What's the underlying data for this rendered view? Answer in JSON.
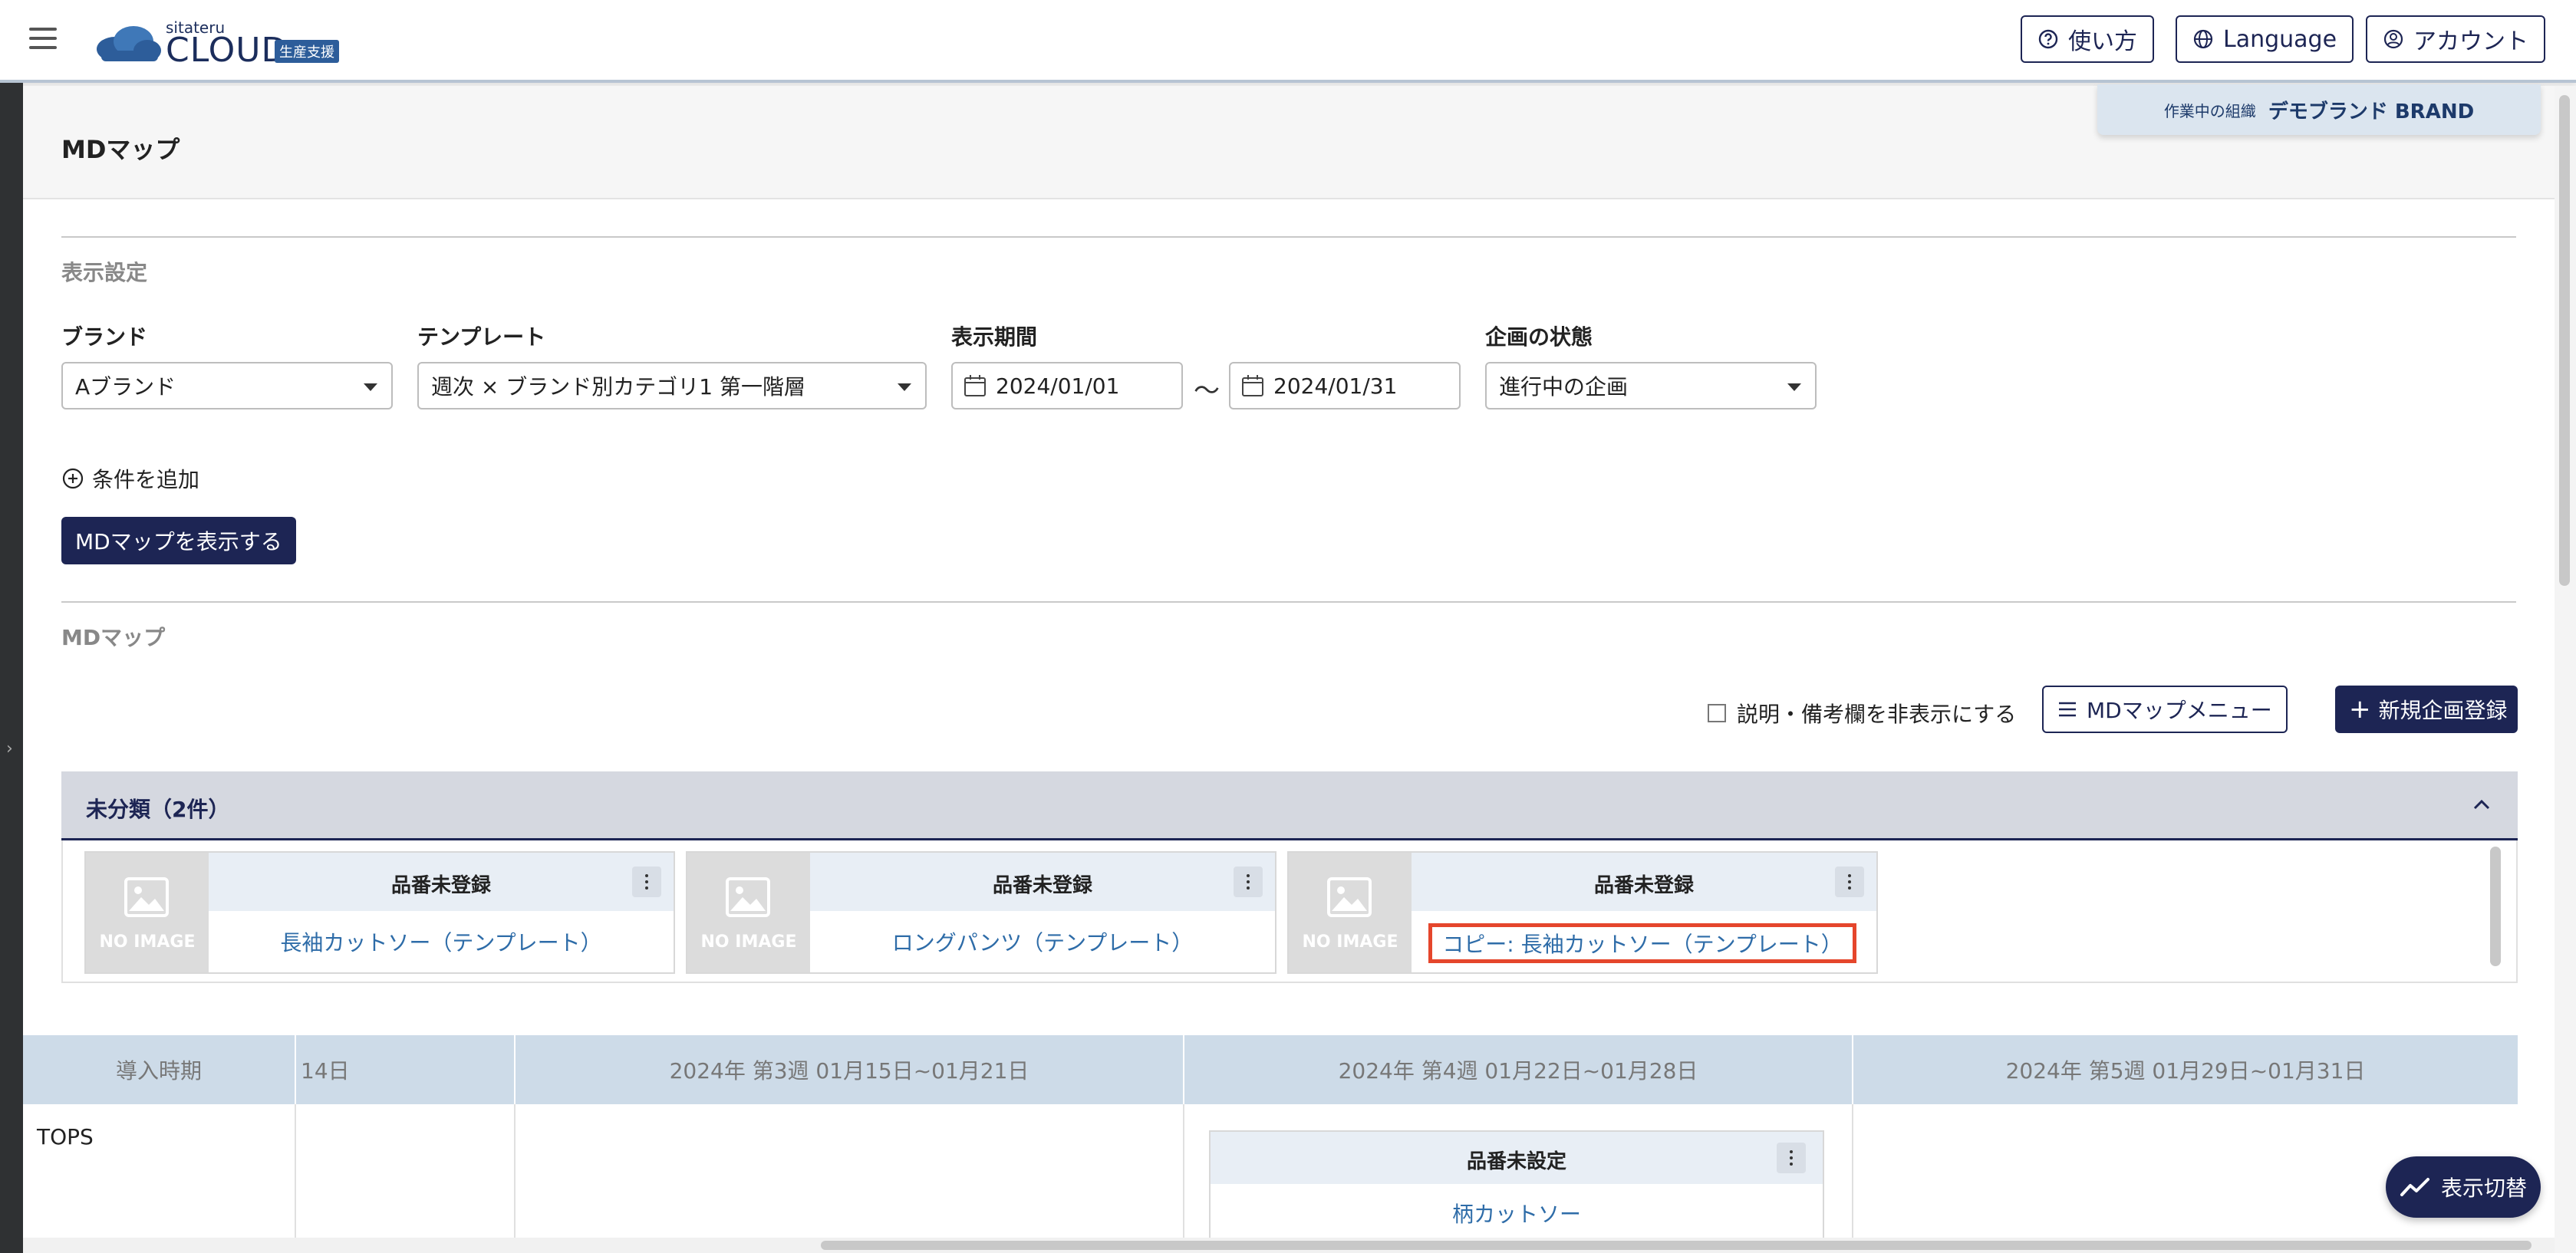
{
  "header": {
    "logo_small": "sitateru",
    "logo_main": "CLOUD",
    "logo_badge": "生産支援",
    "help_label": "使い方",
    "language_label": "Language",
    "account_label": "アカウント"
  },
  "org": {
    "label": "作業中の組織",
    "value": "デモブランド BRAND"
  },
  "page": {
    "title": "MDマップ"
  },
  "settings": {
    "section_title": "表示設定",
    "brand_label": "ブランド",
    "brand_value": "Aブランド",
    "template_label": "テンプレート",
    "template_value": "週次 × ブランド別カテゴリ1 第一階層",
    "period_label": "表示期間",
    "period_start": "2024/01/01",
    "period_tilde": "〜",
    "period_end": "2024/01/31",
    "status_label": "企画の状態",
    "status_value": "進行中の企画",
    "add_condition": "条件を追加",
    "show_button": "MDマップを表示する"
  },
  "mdmap": {
    "section_title": "MDマップ",
    "hide_notes_label": "説明・備考欄を非表示にする",
    "menu_button": "MDマップメニュー",
    "new_button": "新規企画登録"
  },
  "uncategorized": {
    "title": "未分類（2件）",
    "cards": [
      {
        "code": "品番未登録",
        "name": "長袖カットソー（テンプレート）",
        "noimage": "NO IMAGE"
      },
      {
        "code": "品番未登録",
        "name": "ロングパンツ（テンプレート）",
        "noimage": "NO IMAGE"
      },
      {
        "code": "品番未登録",
        "name": "コピー: 長袖カットソー（テンプレート）",
        "noimage": "NO IMAGE"
      }
    ]
  },
  "timeline": {
    "columns": [
      "導入時期",
      "14日",
      "2024年 第3週 01月15日~01月21日",
      "2024年 第4週 01月22日~01月28日",
      "2024年 第5週 01月29日~01月31日"
    ],
    "rows": [
      {
        "label": "TOPS",
        "card": {
          "code": "品番未設定",
          "name": "柄カットソー"
        }
      }
    ]
  },
  "fab": {
    "label": "表示切替"
  },
  "colors": {
    "primary": "#1d2554",
    "link": "#2e6ca8",
    "highlight": "#e5462c",
    "group_bg": "#d5d8e0",
    "timeline_head_bg": "#cddbe8"
  }
}
